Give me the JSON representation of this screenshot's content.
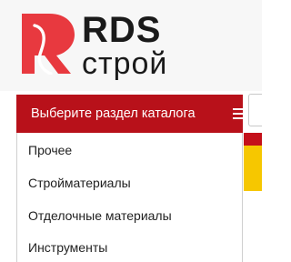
{
  "logo": {
    "name": "RDS",
    "sub": "строй",
    "brand_color": "#e8393f",
    "text_color": "#1a1a1a"
  },
  "catalog": {
    "button_label": "Выберите раздел каталога",
    "button_color": "#b8111a",
    "menu_icon": "hamburger-icon",
    "items": [
      {
        "label": "Прочее"
      },
      {
        "label": "Стройматериалы"
      },
      {
        "label": "Отделочные материалы"
      },
      {
        "label": "Инструменты"
      }
    ]
  },
  "banner": {
    "colors": [
      "#c4101a",
      "#f6c700"
    ]
  }
}
